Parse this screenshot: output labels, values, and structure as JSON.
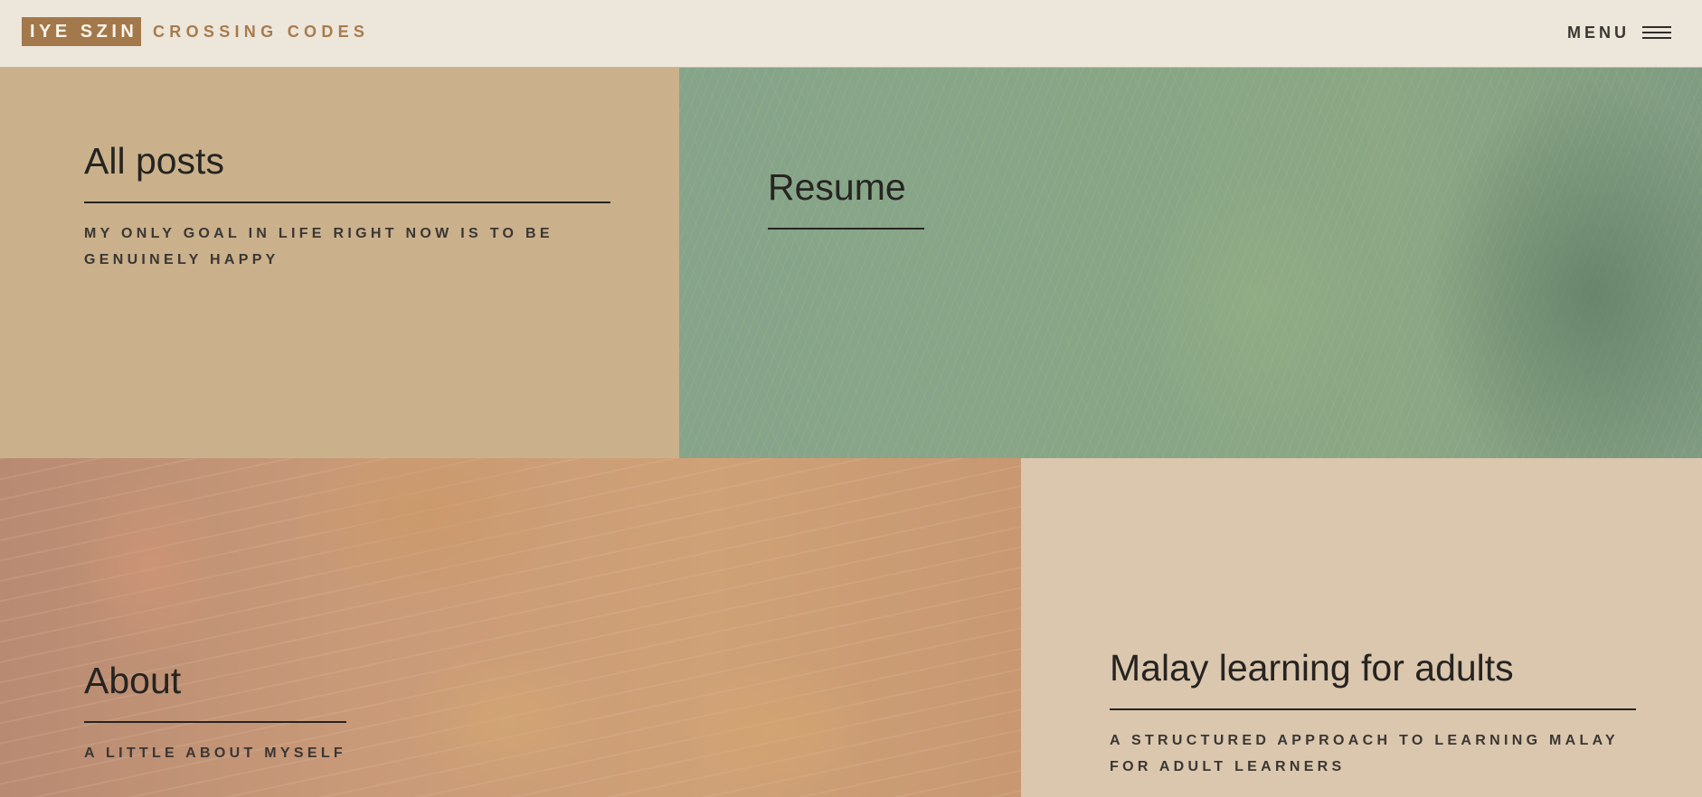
{
  "header": {
    "logo_text": "IYE SZIN",
    "tagline": "CROSSING CODES",
    "menu_label": "MENU"
  },
  "tiles": [
    {
      "title": "All posts",
      "subtitle": "MY ONLY GOAL IN LIFE RIGHT NOW IS TO BE GENUINELY HAPPY",
      "color": "#cab18c"
    },
    {
      "title": "Resume",
      "subtitle": "",
      "color": "#86a48a"
    },
    {
      "title": "About",
      "subtitle": "A LITTLE ABOUT MYSELF",
      "color": "#c99c76"
    },
    {
      "title": "Malay learning for adults",
      "subtitle": "A STRUCTURED APPROACH TO LEARNING MALAY FOR ADULT LEARNERS",
      "color": "#dac7ae"
    }
  ],
  "colors": {
    "header_bg": "#ede6db",
    "brand": "#a3784b",
    "text_dark": "#262421"
  },
  "icons": {
    "menu": "hamburger-icon"
  }
}
